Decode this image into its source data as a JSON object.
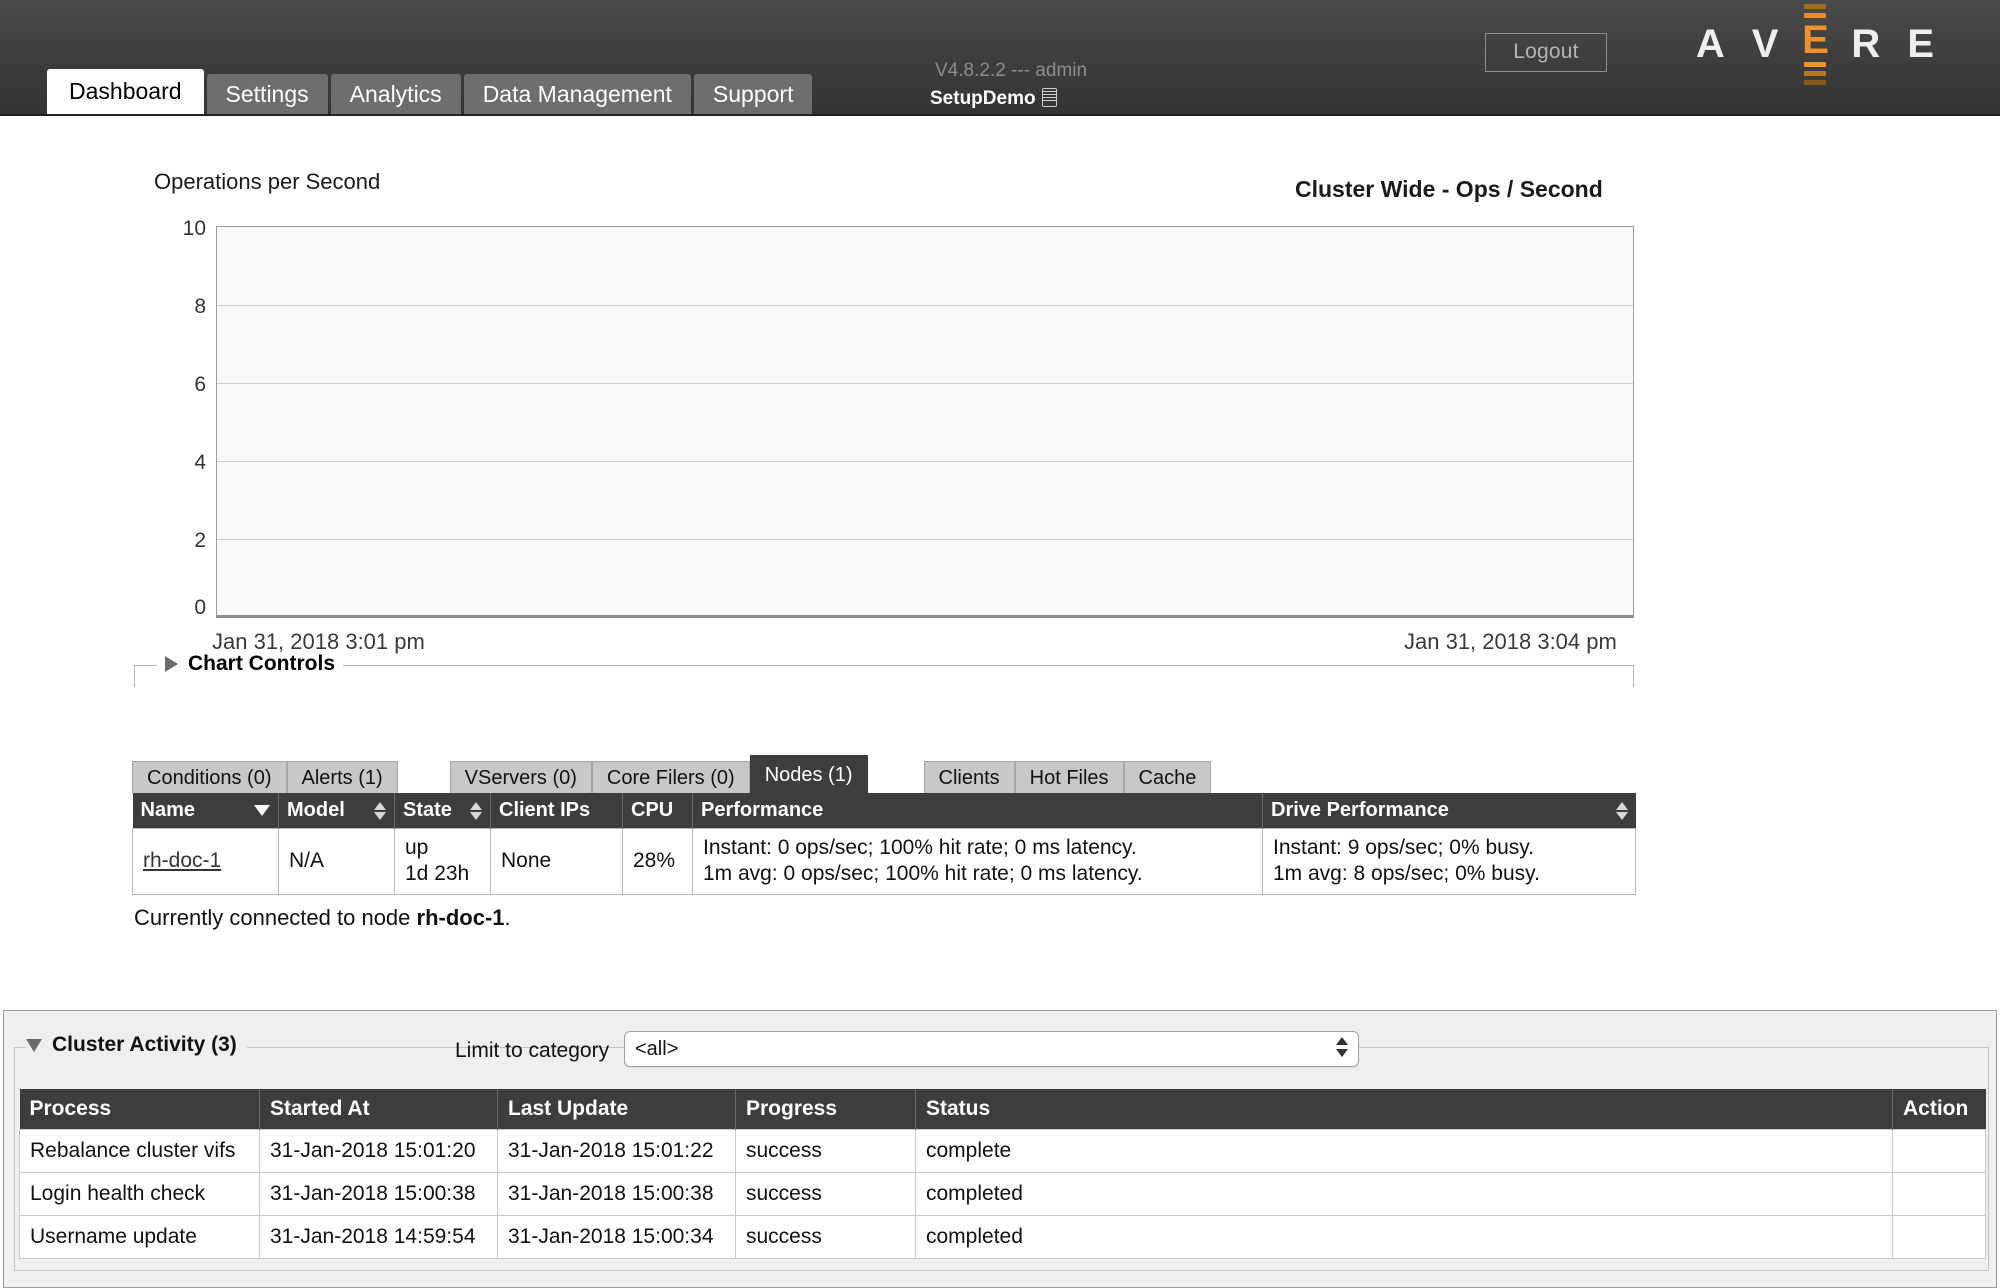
{
  "header": {
    "logout_label": "Logout",
    "logo_letters": [
      "A",
      "V",
      "E",
      "R",
      "E"
    ],
    "version_line": "V4.8.2.2 --- admin",
    "cluster_name": "SetupDemo",
    "tabs": [
      {
        "label": "Dashboard",
        "active": true
      },
      {
        "label": "Settings",
        "active": false
      },
      {
        "label": "Analytics",
        "active": false
      },
      {
        "label": "Data Management",
        "active": false
      },
      {
        "label": "Support",
        "active": false
      }
    ]
  },
  "chart_data": {
    "type": "line",
    "title": "Cluster Wide - Ops / Second",
    "ylabel": "Operations per Second",
    "xlabel": "",
    "yticks": [
      "10",
      "8",
      "6",
      "4",
      "2",
      "0"
    ],
    "ylim": [
      0,
      10
    ],
    "grid": true,
    "legend": "none",
    "series": [
      {
        "name": "Cluster Wide - Ops / Second",
        "values": []
      }
    ],
    "x_start_label": "Jan 31, 2018 3:01 pm",
    "x_end_label": "Jan 31, 2018 3:04 pm",
    "plot_empty": true
  },
  "chart_controls": {
    "label": "Chart Controls",
    "expanded": false
  },
  "status_tabs": {
    "group1": [
      {
        "label": "Conditions (0)",
        "active": false
      },
      {
        "label": "Alerts (1)",
        "active": false
      }
    ],
    "group2": [
      {
        "label": "VServers (0)",
        "active": false
      },
      {
        "label": "Core Filers (0)",
        "active": false
      },
      {
        "label": "Nodes (1)",
        "active": true
      }
    ],
    "group3": [
      {
        "label": "Clients",
        "active": false
      },
      {
        "label": "Hot Files",
        "active": false
      },
      {
        "label": "Cache",
        "active": false
      }
    ]
  },
  "nodes_table": {
    "columns": [
      {
        "label": "Name",
        "sort": "desc"
      },
      {
        "label": "Model",
        "sort": "both"
      },
      {
        "label": "State",
        "sort": "both"
      },
      {
        "label": "Client IPs",
        "sort": "none"
      },
      {
        "label": "CPU",
        "sort": "none"
      },
      {
        "label": "Performance",
        "sort": "none"
      },
      {
        "label": "Drive Performance",
        "sort": "both"
      }
    ],
    "rows": [
      {
        "name": "rh-doc-1",
        "model": "N/A",
        "state_line1": "up",
        "state_line2": "1d 23h",
        "client_ips": "None",
        "cpu": "28%",
        "perf_line1": "Instant:  0 ops/sec; 100% hit rate; 0 ms latency.",
        "perf_line2": "1m avg: 0 ops/sec; 100% hit rate; 0 ms latency.",
        "drive_line1": "Instant:   9 ops/sec;  0% busy.",
        "drive_line2": "1m avg:  8 ops/sec;  0% busy."
      }
    ],
    "footer_prefix": "Currently connected to node ",
    "footer_node": "rh-doc-1",
    "footer_suffix": "."
  },
  "cluster_activity": {
    "title": "Cluster Activity (3)",
    "expanded": true,
    "limit_label": "Limit to category",
    "category_value": "<all>",
    "columns": [
      "Process",
      "Started At",
      "Last Update",
      "Progress",
      "Status",
      "Action"
    ],
    "rows": [
      {
        "process": "Rebalance cluster vifs",
        "started_at": "31-Jan-2018 15:01:20",
        "last_update": "31-Jan-2018 15:01:22",
        "progress": "success",
        "status": "complete",
        "action": ""
      },
      {
        "process": "Login health check",
        "started_at": "31-Jan-2018 15:00:38",
        "last_update": "31-Jan-2018 15:00:38",
        "progress": "success",
        "status": "completed",
        "action": ""
      },
      {
        "process": "Username update",
        "started_at": "31-Jan-2018 14:59:54",
        "last_update": "31-Jan-2018 15:00:34",
        "progress": "success",
        "status": "completed",
        "action": ""
      }
    ]
  }
}
